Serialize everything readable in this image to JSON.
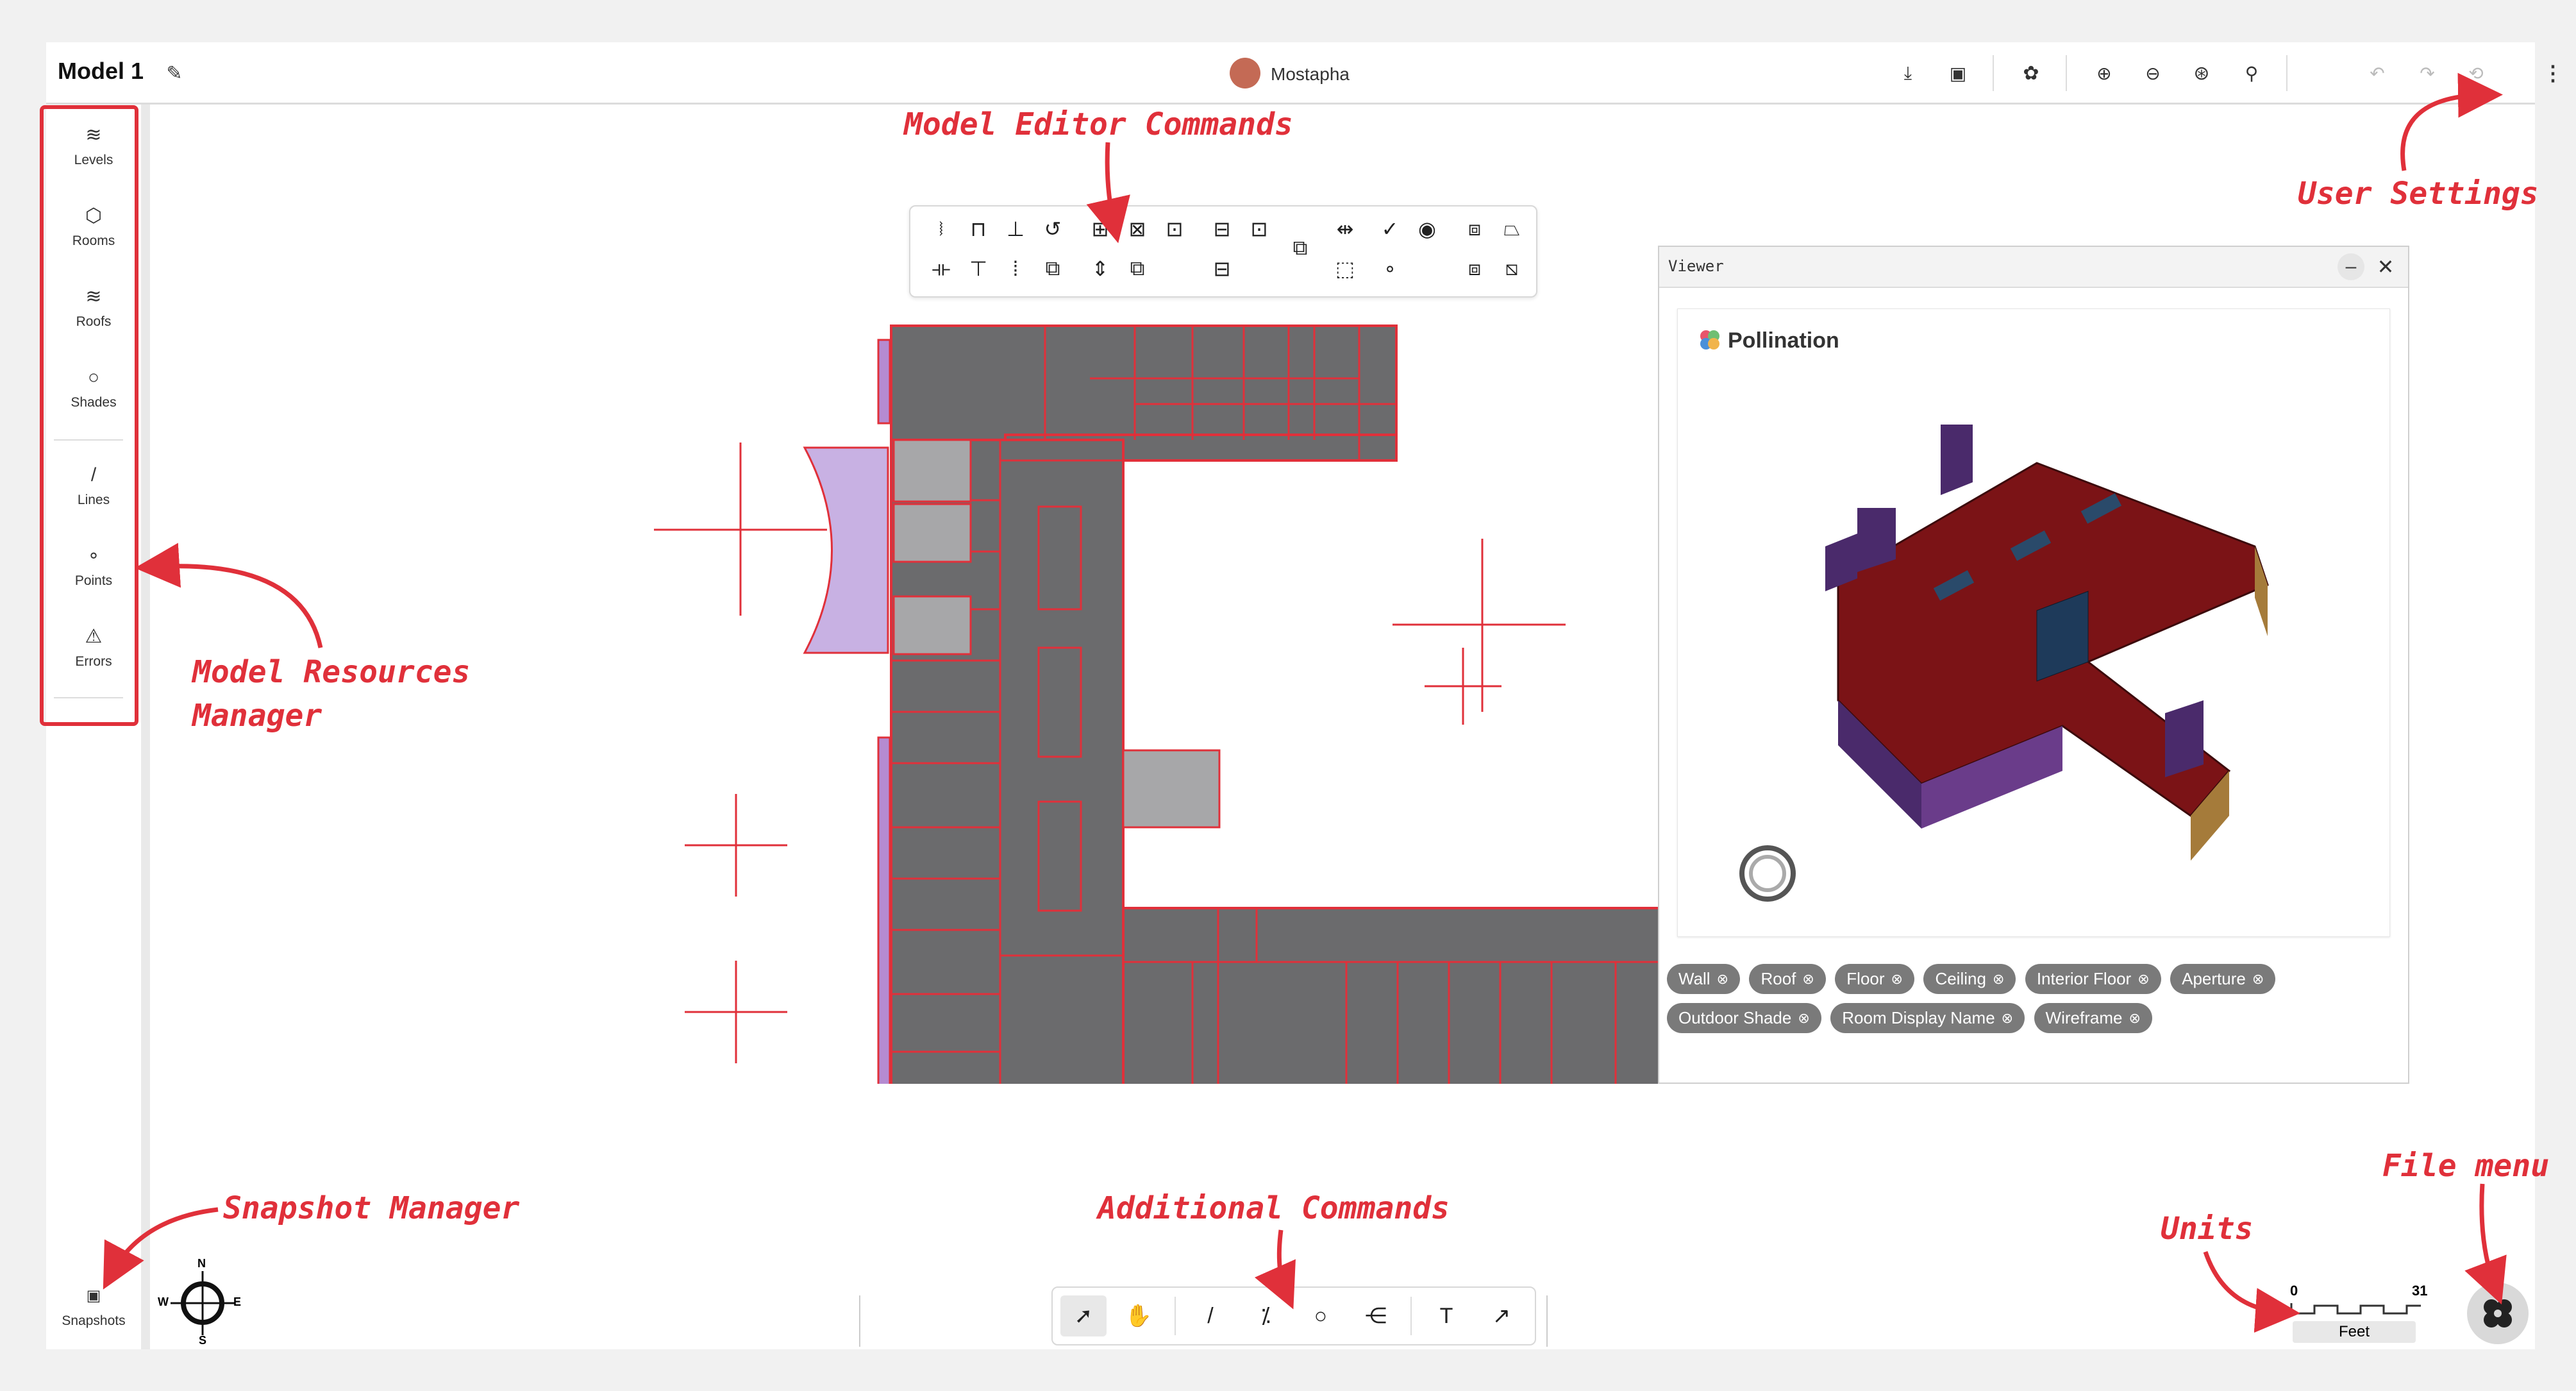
{
  "window": {
    "title": "Model 1",
    "user_name": "Mostapha"
  },
  "topbar_icons": [
    "download-icon",
    "save-icon",
    "pollination-icon",
    "zoom-in-icon",
    "zoom-out-icon",
    "zoom-fit-icon",
    "zoom-icon",
    "undo-icon",
    "redo-icon",
    "reset-icon",
    "kebab-menu-icon"
  ],
  "sidebar": {
    "items": [
      {
        "label": "Levels",
        "icon": "layers-icon",
        "glyph": "≋"
      },
      {
        "label": "Rooms",
        "icon": "cube-icon",
        "glyph": "⬡"
      },
      {
        "label": "Roofs",
        "icon": "roof-layers-icon",
        "glyph": "≋"
      },
      {
        "label": "Shades",
        "icon": "circle-icon",
        "glyph": "○"
      },
      {
        "label": "Lines",
        "icon": "line-icon",
        "glyph": "/"
      },
      {
        "label": "Points",
        "icon": "point-icon",
        "glyph": "∘"
      },
      {
        "label": "Errors",
        "icon": "warning-icon",
        "glyph": "⚠"
      }
    ],
    "snapshots_label": "Snapshots"
  },
  "compass": {
    "n": "N",
    "e": "E",
    "s": "S",
    "w": "W"
  },
  "annotations": {
    "model_editor_commands": "Model Editor Commands",
    "user_settings": "User Settings",
    "model_resources_line1": "Model Resources",
    "model_resources_line2": "Manager",
    "snapshot_manager": "Snapshot Manager",
    "additional_commands": "Additional Commands",
    "units": "Units",
    "file_menu": "File menu"
  },
  "viewer": {
    "title": "Viewer",
    "brand": "Pollination",
    "filters": [
      "Wall",
      "Roof",
      "Floor",
      "Ceiling",
      "Interior Floor",
      "Aperture",
      "Outdoor Shade",
      "Room Display Name",
      "Wireframe"
    ]
  },
  "scale": {
    "start": "0",
    "end": "31",
    "unit": "Feet"
  },
  "colors": {
    "accent": "#e0303a",
    "room_fill": "#6b6b6d",
    "shade_fill": "#b7a2dc",
    "roof": "#7b1316",
    "shade3d": "#4a2a6b"
  }
}
